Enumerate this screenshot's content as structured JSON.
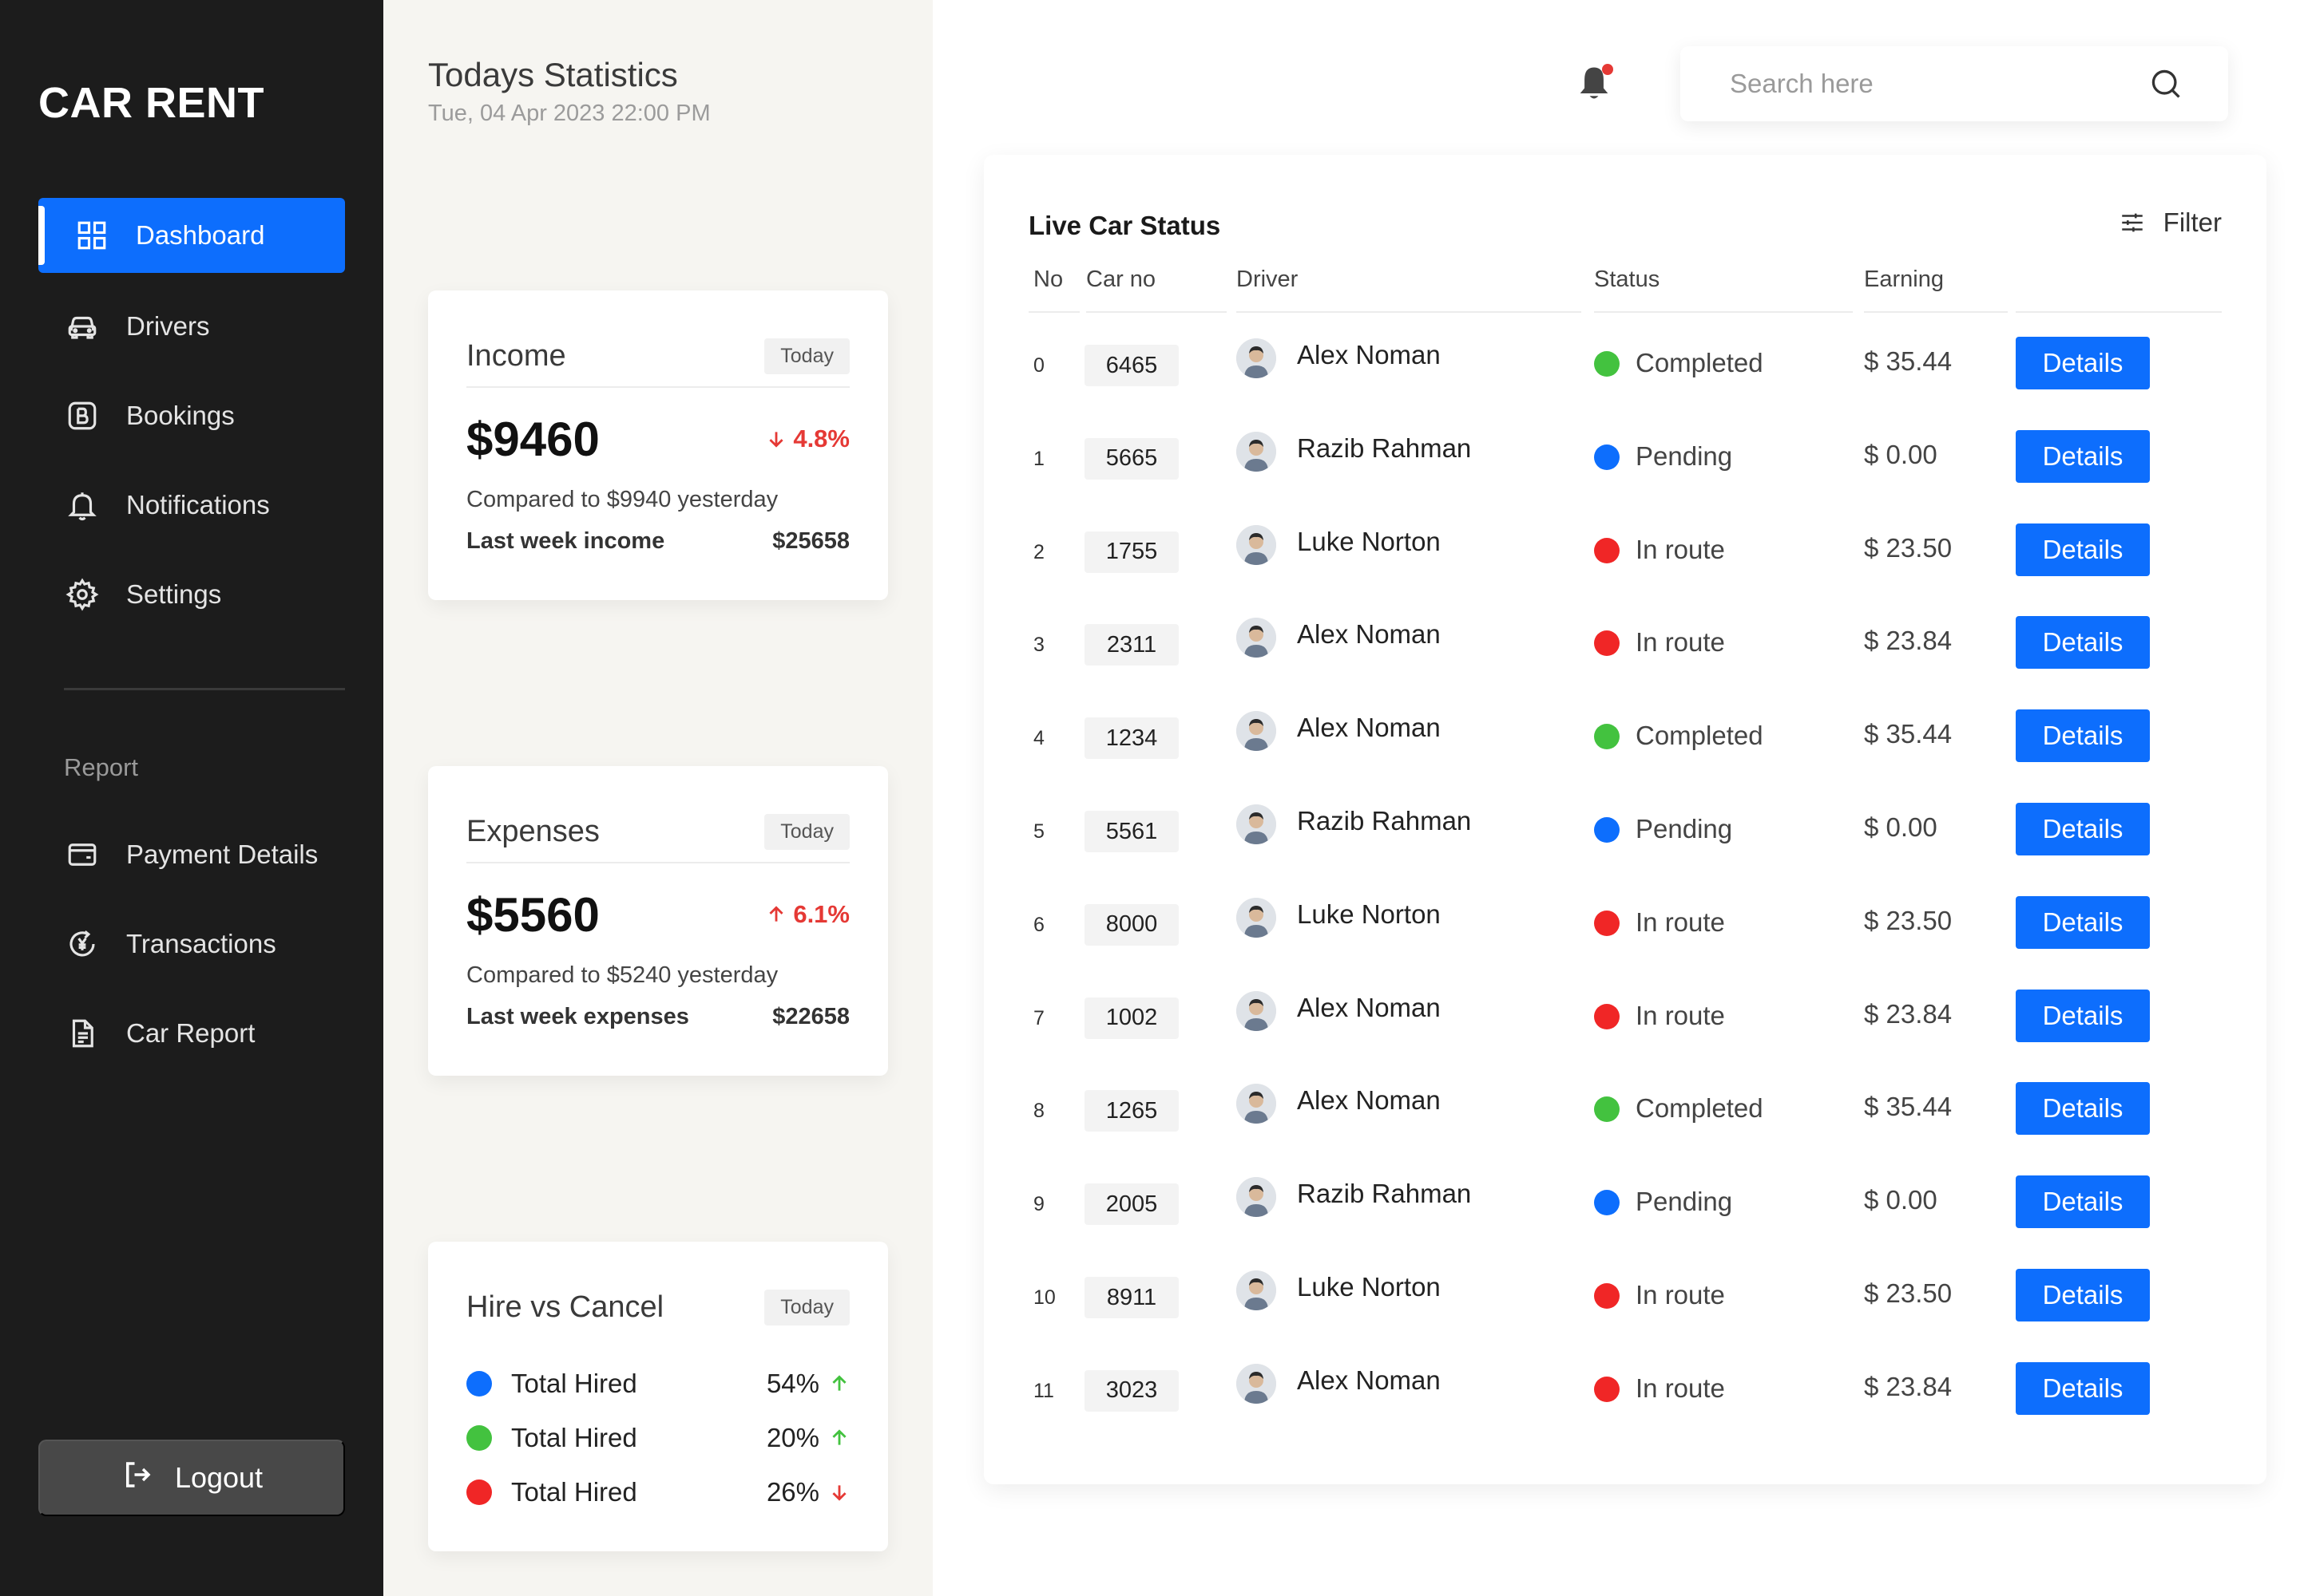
{
  "app": {
    "brand": "CAR RENT"
  },
  "sidebar": {
    "items": [
      {
        "label": "Dashboard",
        "icon": "dashboard-icon",
        "active": true
      },
      {
        "label": "Drivers",
        "icon": "car-icon"
      },
      {
        "label": "Bookings",
        "icon": "bookings-icon"
      },
      {
        "label": "Notifications",
        "icon": "bell-icon"
      },
      {
        "label": "Settings",
        "icon": "gear-icon"
      }
    ],
    "report_label": "Report",
    "report_items": [
      {
        "label": "Payment Details",
        "icon": "wallet-icon"
      },
      {
        "label": "Transactions",
        "icon": "currency-exchange-icon"
      },
      {
        "label": "Car Report",
        "icon": "document-icon"
      }
    ],
    "logout_label": "Logout"
  },
  "stats": {
    "title": "Todays Statistics",
    "date": "Tue, 04 Apr 2023 22:00 PM",
    "income": {
      "title": "Income",
      "pill": "Today",
      "amount": "$9460",
      "delta": "4.8%",
      "delta_direction": "down",
      "delta_color": "#e53935",
      "compare": "Compared to $9940 yesterday",
      "lastweek_label": "Last week income",
      "lastweek_value": "$25658"
    },
    "expenses": {
      "title": "Expenses",
      "pill": "Today",
      "amount": "$5560",
      "delta": "6.1%",
      "delta_direction": "up",
      "delta_color": "#e53935",
      "compare": "Compared to $5240 yesterday",
      "lastweek_label": "Last week expenses",
      "lastweek_value": "$22658"
    },
    "hire_vs_cancel": {
      "title": "Hire vs Cancel",
      "pill": "Today",
      "rows": [
        {
          "label": "Total Hired",
          "value": "54%",
          "dot_color": "#0d6efd",
          "trend": "up",
          "trend_color": "#43c23f"
        },
        {
          "label": "Total Hired",
          "value": "20%",
          "dot_color": "#43c23f",
          "trend": "up",
          "trend_color": "#43c23f"
        },
        {
          "label": "Total Hired",
          "value": "26%",
          "dot_color": "#f02626",
          "trend": "down",
          "trend_color": "#e53935"
        }
      ]
    }
  },
  "header": {
    "search_placeholder": "Search here",
    "notification_badge_color": "#e53935"
  },
  "live": {
    "title": "Live Car Status",
    "filter_label": "Filter",
    "columns": [
      "No",
      "Car no",
      "Driver",
      "Status",
      "Earning"
    ],
    "details_label": "Details",
    "status_colors": {
      "Completed": "#43c23f",
      "Pending": "#0d6efd",
      "In route": "#f02626"
    },
    "rows": [
      {
        "no": "0",
        "car": "6465",
        "driver": "Alex Noman",
        "status": "Completed",
        "earning": "$ 35.44"
      },
      {
        "no": "1",
        "car": "5665",
        "driver": "Razib Rahman",
        "status": "Pending",
        "earning": "$ 0.00"
      },
      {
        "no": "2",
        "car": "1755",
        "driver": "Luke Norton",
        "status": "In route",
        "earning": "$ 23.50"
      },
      {
        "no": "3",
        "car": "2311",
        "driver": "Alex Noman",
        "status": "In route",
        "earning": "$ 23.84"
      },
      {
        "no": "4",
        "car": "1234",
        "driver": "Alex Noman",
        "status": "Completed",
        "earning": "$ 35.44"
      },
      {
        "no": "5",
        "car": "5561",
        "driver": "Razib Rahman",
        "status": "Pending",
        "earning": "$ 0.00"
      },
      {
        "no": "6",
        "car": "8000",
        "driver": "Luke Norton",
        "status": "In route",
        "earning": "$ 23.50"
      },
      {
        "no": "7",
        "car": "1002",
        "driver": "Alex Noman",
        "status": "In route",
        "earning": "$ 23.84"
      },
      {
        "no": "8",
        "car": "1265",
        "driver": "Alex Noman",
        "status": "Completed",
        "earning": "$ 35.44"
      },
      {
        "no": "9",
        "car": "2005",
        "driver": "Razib Rahman",
        "status": "Pending",
        "earning": "$ 0.00"
      },
      {
        "no": "10",
        "car": "8911",
        "driver": "Luke Norton",
        "status": "In route",
        "earning": "$ 23.50"
      },
      {
        "no": "11",
        "car": "3023",
        "driver": "Alex Noman",
        "status": "In route",
        "earning": "$ 23.84"
      }
    ]
  }
}
